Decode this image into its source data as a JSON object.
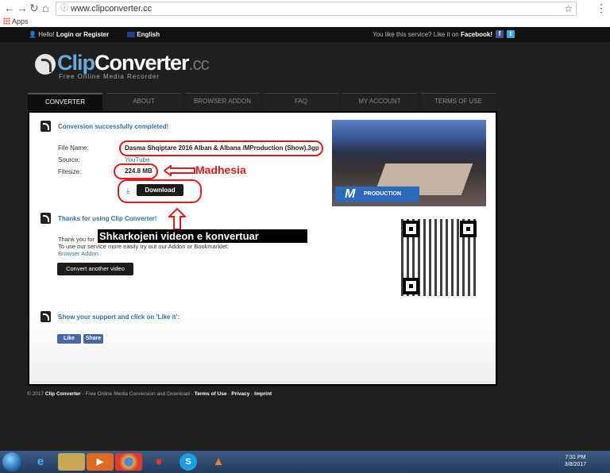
{
  "browser": {
    "url": "www.clipconverter.cc",
    "bookmarks_apps": "Apps"
  },
  "topbar": {
    "hello": "Hello!",
    "login": "Login or Register",
    "language": "English",
    "like_text": "You like this service? Like it on",
    "facebook": "Facebook!",
    "fb_letter": "f",
    "tw_letter": "t"
  },
  "logo": {
    "clip": "Clip",
    "converter": "Converter",
    "cc": ".cc",
    "tagline": "Free Online Media Recorder"
  },
  "tabs": [
    "CONVERTER",
    "ABOUT",
    "BROWSER ADDON",
    "FAQ",
    "MY ACCOUNT",
    "TERMS OF USE"
  ],
  "result": {
    "heading": "Conversion successfully completed!",
    "file_name_label": "File Name:",
    "file_name": "Dasma Shqiptare 2016 Alban & Albana /MProduction (Show).3gp",
    "source_label": "Source:",
    "source": "YouTube",
    "filesize_label": "Filesize:",
    "filesize": "224.8 MB",
    "download_label": "Download"
  },
  "annotations": {
    "size_note": "Madhesia",
    "download_note": "Shkarkojeni videon e konvertuar"
  },
  "thanks": {
    "heading": "Thanks for using Clip Converter!",
    "line1": "Thank you for",
    "line2": "To use our service more easily try out our Addon or Bookmarklet:",
    "addon_link": "Browser Addon",
    "convert_another": "Convert another video"
  },
  "support": {
    "heading": "Show your support and click on 'Like it':",
    "like": "Like",
    "share": "Share"
  },
  "thumbnail": {
    "brand": "PRODUCTION"
  },
  "footer": {
    "copyright": "© 2017",
    "brand": "Clip Converter",
    "desc": "- Free Online Media Conversion and Download -",
    "terms": "Terms of Use",
    "privacy": "Privacy",
    "imprint": "Imprint"
  },
  "taskbar": {
    "time": "7:31 PM",
    "date": "3/8/2017"
  }
}
